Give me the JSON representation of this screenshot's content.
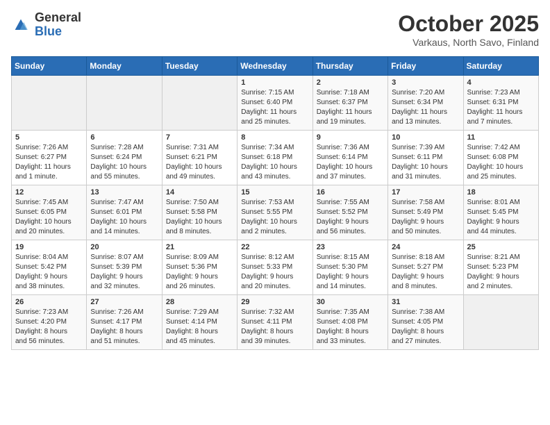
{
  "header": {
    "logo_general": "General",
    "logo_blue": "Blue",
    "month_title": "October 2025",
    "location": "Varkaus, North Savo, Finland"
  },
  "days_of_week": [
    "Sunday",
    "Monday",
    "Tuesday",
    "Wednesday",
    "Thursday",
    "Friday",
    "Saturday"
  ],
  "weeks": [
    [
      {
        "day": "",
        "info": ""
      },
      {
        "day": "",
        "info": ""
      },
      {
        "day": "",
        "info": ""
      },
      {
        "day": "1",
        "info": "Sunrise: 7:15 AM\nSunset: 6:40 PM\nDaylight: 11 hours\nand 25 minutes."
      },
      {
        "day": "2",
        "info": "Sunrise: 7:18 AM\nSunset: 6:37 PM\nDaylight: 11 hours\nand 19 minutes."
      },
      {
        "day": "3",
        "info": "Sunrise: 7:20 AM\nSunset: 6:34 PM\nDaylight: 11 hours\nand 13 minutes."
      },
      {
        "day": "4",
        "info": "Sunrise: 7:23 AM\nSunset: 6:31 PM\nDaylight: 11 hours\nand 7 minutes."
      }
    ],
    [
      {
        "day": "5",
        "info": "Sunrise: 7:26 AM\nSunset: 6:27 PM\nDaylight: 11 hours\nand 1 minute."
      },
      {
        "day": "6",
        "info": "Sunrise: 7:28 AM\nSunset: 6:24 PM\nDaylight: 10 hours\nand 55 minutes."
      },
      {
        "day": "7",
        "info": "Sunrise: 7:31 AM\nSunset: 6:21 PM\nDaylight: 10 hours\nand 49 minutes."
      },
      {
        "day": "8",
        "info": "Sunrise: 7:34 AM\nSunset: 6:18 PM\nDaylight: 10 hours\nand 43 minutes."
      },
      {
        "day": "9",
        "info": "Sunrise: 7:36 AM\nSunset: 6:14 PM\nDaylight: 10 hours\nand 37 minutes."
      },
      {
        "day": "10",
        "info": "Sunrise: 7:39 AM\nSunset: 6:11 PM\nDaylight: 10 hours\nand 31 minutes."
      },
      {
        "day": "11",
        "info": "Sunrise: 7:42 AM\nSunset: 6:08 PM\nDaylight: 10 hours\nand 25 minutes."
      }
    ],
    [
      {
        "day": "12",
        "info": "Sunrise: 7:45 AM\nSunset: 6:05 PM\nDaylight: 10 hours\nand 20 minutes."
      },
      {
        "day": "13",
        "info": "Sunrise: 7:47 AM\nSunset: 6:01 PM\nDaylight: 10 hours\nand 14 minutes."
      },
      {
        "day": "14",
        "info": "Sunrise: 7:50 AM\nSunset: 5:58 PM\nDaylight: 10 hours\nand 8 minutes."
      },
      {
        "day": "15",
        "info": "Sunrise: 7:53 AM\nSunset: 5:55 PM\nDaylight: 10 hours\nand 2 minutes."
      },
      {
        "day": "16",
        "info": "Sunrise: 7:55 AM\nSunset: 5:52 PM\nDaylight: 9 hours\nand 56 minutes."
      },
      {
        "day": "17",
        "info": "Sunrise: 7:58 AM\nSunset: 5:49 PM\nDaylight: 9 hours\nand 50 minutes."
      },
      {
        "day": "18",
        "info": "Sunrise: 8:01 AM\nSunset: 5:45 PM\nDaylight: 9 hours\nand 44 minutes."
      }
    ],
    [
      {
        "day": "19",
        "info": "Sunrise: 8:04 AM\nSunset: 5:42 PM\nDaylight: 9 hours\nand 38 minutes."
      },
      {
        "day": "20",
        "info": "Sunrise: 8:07 AM\nSunset: 5:39 PM\nDaylight: 9 hours\nand 32 minutes."
      },
      {
        "day": "21",
        "info": "Sunrise: 8:09 AM\nSunset: 5:36 PM\nDaylight: 9 hours\nand 26 minutes."
      },
      {
        "day": "22",
        "info": "Sunrise: 8:12 AM\nSunset: 5:33 PM\nDaylight: 9 hours\nand 20 minutes."
      },
      {
        "day": "23",
        "info": "Sunrise: 8:15 AM\nSunset: 5:30 PM\nDaylight: 9 hours\nand 14 minutes."
      },
      {
        "day": "24",
        "info": "Sunrise: 8:18 AM\nSunset: 5:27 PM\nDaylight: 9 hours\nand 8 minutes."
      },
      {
        "day": "25",
        "info": "Sunrise: 8:21 AM\nSunset: 5:23 PM\nDaylight: 9 hours\nand 2 minutes."
      }
    ],
    [
      {
        "day": "26",
        "info": "Sunrise: 7:23 AM\nSunset: 4:20 PM\nDaylight: 8 hours\nand 56 minutes."
      },
      {
        "day": "27",
        "info": "Sunrise: 7:26 AM\nSunset: 4:17 PM\nDaylight: 8 hours\nand 51 minutes."
      },
      {
        "day": "28",
        "info": "Sunrise: 7:29 AM\nSunset: 4:14 PM\nDaylight: 8 hours\nand 45 minutes."
      },
      {
        "day": "29",
        "info": "Sunrise: 7:32 AM\nSunset: 4:11 PM\nDaylight: 8 hours\nand 39 minutes."
      },
      {
        "day": "30",
        "info": "Sunrise: 7:35 AM\nSunset: 4:08 PM\nDaylight: 8 hours\nand 33 minutes."
      },
      {
        "day": "31",
        "info": "Sunrise: 7:38 AM\nSunset: 4:05 PM\nDaylight: 8 hours\nand 27 minutes."
      },
      {
        "day": "",
        "info": ""
      }
    ]
  ]
}
